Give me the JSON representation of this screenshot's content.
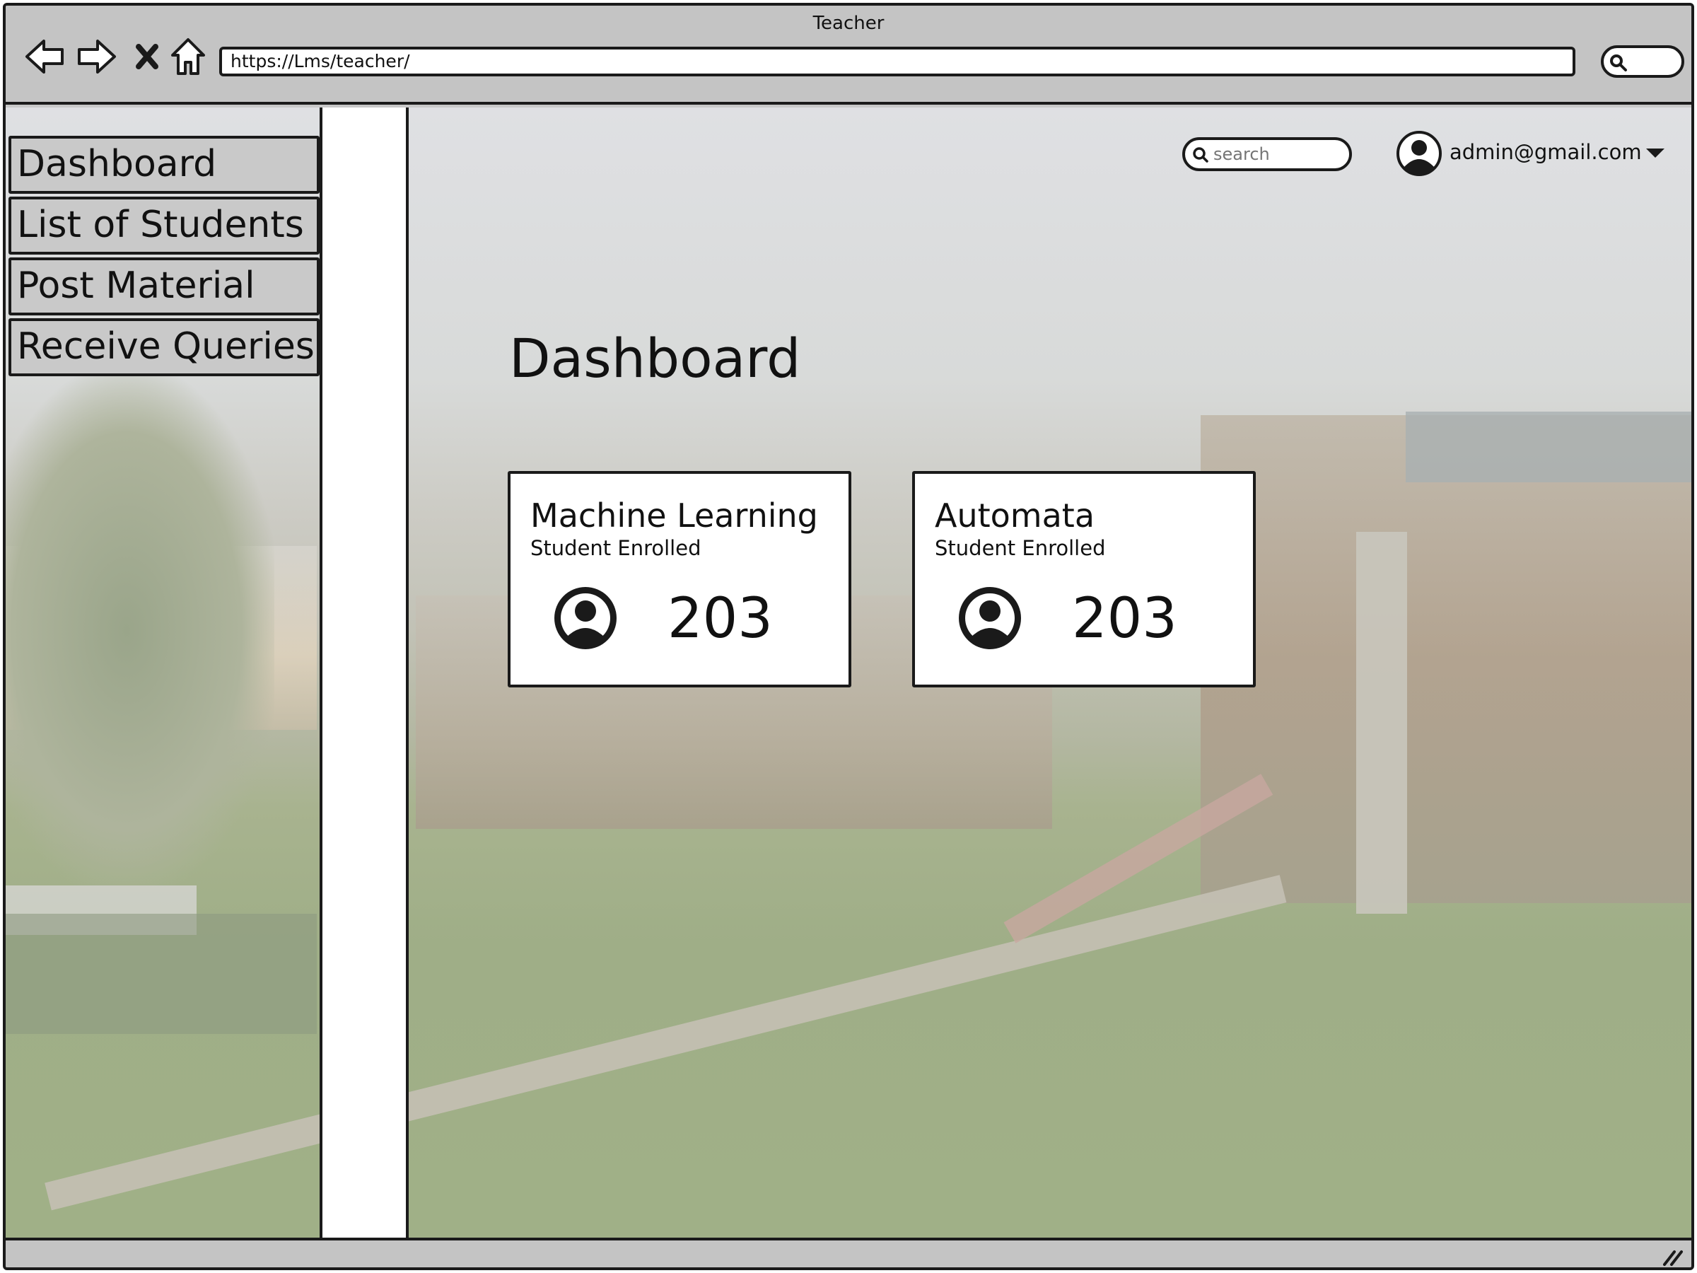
{
  "window": {
    "title": "Teacher"
  },
  "browser": {
    "url": "https://Lms/teacher/"
  },
  "sidebar": {
    "items": [
      {
        "label": "Dashboard"
      },
      {
        "label": "List of Students"
      },
      {
        "label": "Post Material"
      },
      {
        "label": "Receive Queries"
      }
    ]
  },
  "header": {
    "search_placeholder": "search",
    "user_email": "admin@gmail.com"
  },
  "main": {
    "title": "Dashboard",
    "cards": [
      {
        "course": "Machine Learning",
        "subtitle": "Student Enrolled",
        "count": "203"
      },
      {
        "course": "Automata",
        "subtitle": "Student Enrolled",
        "count": "203"
      }
    ]
  },
  "icons": {
    "back": "back-arrow-icon",
    "forward": "forward-arrow-icon",
    "stop": "close-icon",
    "home": "home-icon",
    "search": "search-icon",
    "user": "user-avatar-icon",
    "dropdown": "chevron-down-icon"
  },
  "colors": {
    "chrome": "#c4c4c4",
    "border": "#1a1a1a",
    "card": "#ffffff"
  }
}
